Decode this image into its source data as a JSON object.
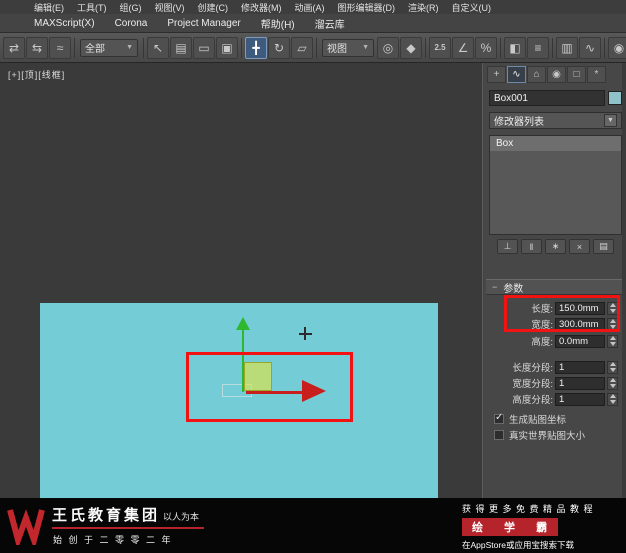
{
  "menu": {
    "row1": [
      "编辑(E)",
      "工具(T)",
      "组(G)",
      "视图(V)",
      "创建(C)",
      "修改器(M)",
      "动画(A)",
      "图形编辑器(D)",
      "渲染(R)",
      "自定义(U)"
    ],
    "row2": [
      "MAXScript(X)",
      "Corona",
      "Project Manager",
      "帮助(H)",
      "溜云库"
    ]
  },
  "toolbar": {
    "selection_filter": "全部",
    "coord_system": "视图",
    "snap_label": "2.5"
  },
  "viewport": {
    "label": "[+][顶][线框]"
  },
  "command_panel": {
    "object_name": "Box001",
    "modifier_list": "修改器列表",
    "stack_items": [
      "Box"
    ],
    "rollout_title": "参数",
    "params": [
      {
        "label": "长度:",
        "value": "150.0mm"
      },
      {
        "label": "宽度:",
        "value": "300.0mm"
      },
      {
        "label": "高度:",
        "value": "0.0mm"
      },
      {
        "label": "长度分段:",
        "value": "1"
      },
      {
        "label": "宽度分段:",
        "value": "1"
      },
      {
        "label": "高度分段:",
        "value": "1"
      }
    ],
    "checkboxes": [
      {
        "label": "生成贴图坐标",
        "checked": true
      },
      {
        "label": "真实世界贴图大小",
        "checked": false
      }
    ]
  },
  "watermark": {
    "brand": "王氏教育集团",
    "slogan": "以人为本",
    "since": "始 创 于 二 零 零 二 年",
    "promo_top": "获 得 更 多 免 费 精 品 教 程",
    "promo_brand": "绘 学 霸",
    "promo_bottom": "在AppStore或应用宝搜索下载"
  }
}
